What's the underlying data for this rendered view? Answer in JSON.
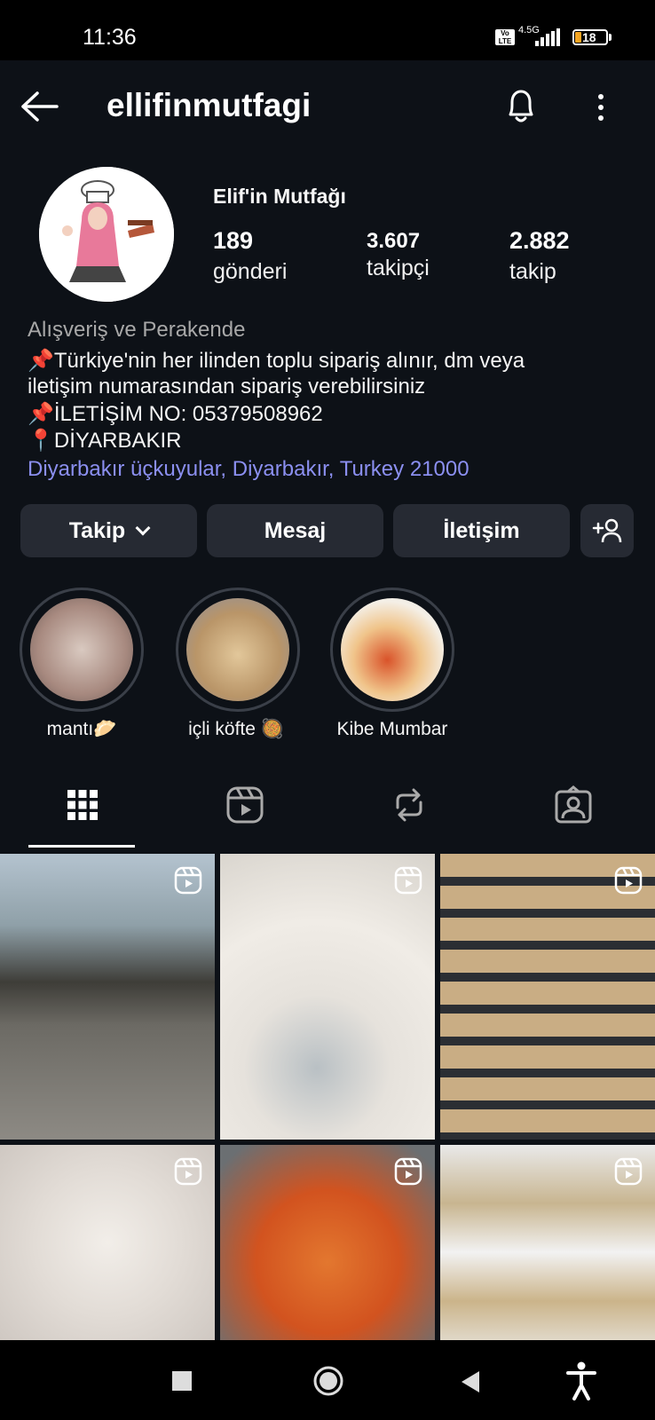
{
  "status": {
    "time": "11:36",
    "volte": "Vo LTE",
    "network": "4.5G",
    "battery": "18"
  },
  "header": {
    "username": "ellifinmutfagi"
  },
  "profile": {
    "display_name": "Elif'in Mutfağı",
    "posts_count": "189",
    "posts_label": "gönderi",
    "followers_count": "3.607",
    "followers_label": "takipçi",
    "following_count": "2.882",
    "following_label": "takip",
    "category": "Alışveriş ve Perakende",
    "bio_lines": [
      "📌Türkiye'nin her ilinden toplu sipariş alınır, dm veya",
      "iletişim numarasından sipariş verebilirsiniz",
      "📌İLETİŞİM NO: 05379508962",
      "📍DİYARBAKIR"
    ],
    "location": "Diyarbakır üçkuyular, Diyarbakır, Turkey 21000"
  },
  "actions": {
    "follow": "Takip",
    "message": "Mesaj",
    "contact": "İletişim"
  },
  "highlights": [
    {
      "label": "mantı🥟"
    },
    {
      "label": "içli köfte 🥘"
    },
    {
      "label": "Kibe Mumbar"
    }
  ],
  "colors": {
    "background": "#0d1117",
    "button": "#262a33",
    "link": "#8b8ff0"
  }
}
